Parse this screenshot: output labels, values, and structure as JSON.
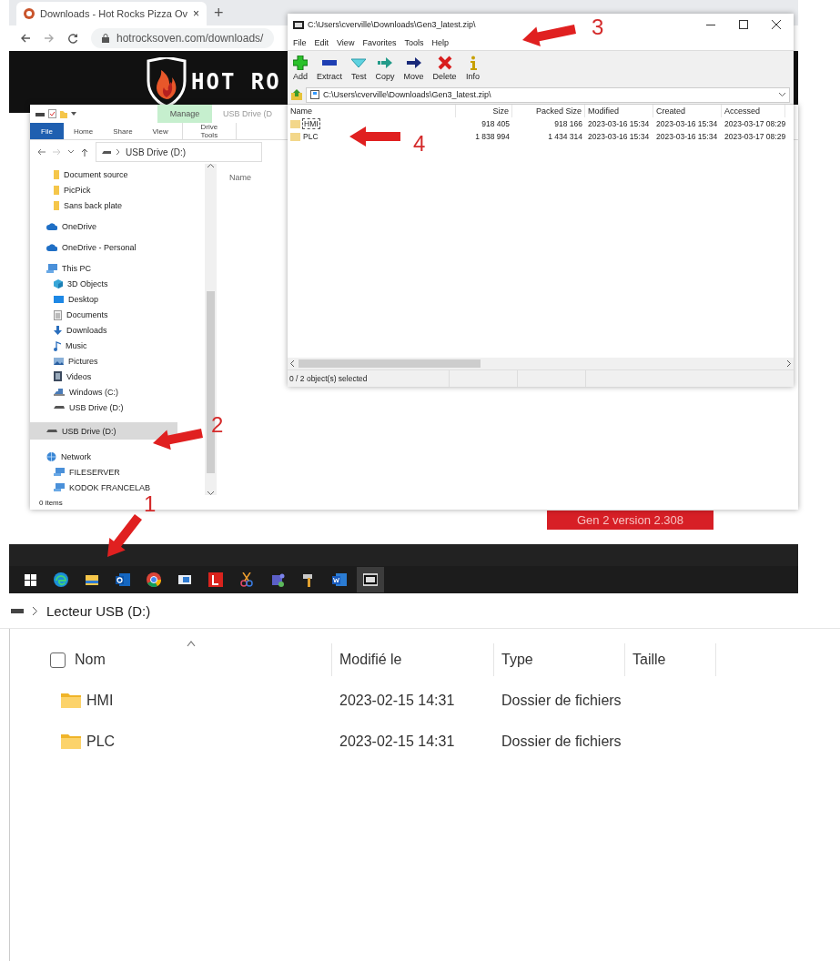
{
  "browser": {
    "tab_title": "Downloads - Hot Rocks Pizza Ov",
    "tab_close": "×",
    "new_tab": "+",
    "url": "hotrocksoven.com/downloads/",
    "logo_text": "HOT RO",
    "download_button": "Gen 2 version 2.308"
  },
  "explorer": {
    "contextual_label": "Manage",
    "title": "USB Drive (D",
    "ribbon_tabs": [
      {
        "label": "File",
        "kind": "file"
      },
      {
        "label": "Home",
        "kind": "tab"
      },
      {
        "label": "Share",
        "kind": "tab"
      },
      {
        "label": "View",
        "kind": "tab"
      },
      {
        "label": "Drive Tools",
        "kind": "contextual"
      }
    ],
    "address": "USB Drive (D:)",
    "column": "Name",
    "nav": [
      {
        "label": "Document source",
        "kind": "folder",
        "selected": false
      },
      {
        "label": "PicPick",
        "kind": "folder",
        "selected": false
      },
      {
        "label": "Sans back plate",
        "kind": "folder",
        "selected": false
      },
      {
        "label": "OneDrive",
        "kind": "cloud",
        "selected": false
      },
      {
        "label": "OneDrive - Personal",
        "kind": "cloud",
        "selected": false
      },
      {
        "label": "This PC",
        "kind": "pc",
        "selected": false,
        "children": [
          {
            "label": "3D Objects",
            "kind": "objects",
            "selected": false
          },
          {
            "label": "Desktop",
            "kind": "desktop",
            "selected": false
          },
          {
            "label": "Documents",
            "kind": "documents",
            "selected": false
          },
          {
            "label": "Downloads",
            "kind": "downloads",
            "selected": false
          },
          {
            "label": "Music",
            "kind": "music",
            "selected": false
          },
          {
            "label": "Pictures",
            "kind": "pictures",
            "selected": false
          },
          {
            "label": "Videos",
            "kind": "videos",
            "selected": false
          },
          {
            "label": "Windows (C:)",
            "kind": "disk",
            "selected": false
          },
          {
            "label": "USB Drive (D:)",
            "kind": "usb",
            "selected": false
          }
        ]
      },
      {
        "label": "USB Drive (D:)",
        "kind": "usb",
        "selected": true
      },
      {
        "label": "Network",
        "kind": "network",
        "selected": false,
        "children": [
          {
            "label": "FILESERVER",
            "kind": "server",
            "selected": false
          },
          {
            "label": "KODOK FRANCELAB",
            "kind": "server",
            "selected": false
          }
        ]
      }
    ],
    "status": "0 items"
  },
  "archiver": {
    "title": "C:\\Users\\cverville\\Downloads\\Gen3_latest.zip\\",
    "menu": [
      "File",
      "Edit",
      "View",
      "Favorites",
      "Tools",
      "Help"
    ],
    "toolbar": [
      {
        "label": "Add",
        "kind": "add"
      },
      {
        "label": "Extract",
        "kind": "extract"
      },
      {
        "label": "Test",
        "kind": "test"
      },
      {
        "label": "Copy",
        "kind": "copy"
      },
      {
        "label": "Move",
        "kind": "move"
      },
      {
        "label": "Delete",
        "kind": "delete"
      },
      {
        "label": "Info",
        "kind": "info"
      }
    ],
    "path": "C:\\Users\\cverville\\Downloads\\Gen3_latest.zip\\",
    "columns": [
      "Name",
      "Size",
      "Packed Size",
      "Modified",
      "Created",
      "Accessed"
    ],
    "rows": [
      {
        "cells": [
          "HMI",
          "918 405",
          "918 166",
          "2023-03-16 15:34",
          "2023-03-16 15:34",
          "2023-03-17 08:29"
        ],
        "focused": true
      },
      {
        "cells": [
          "PLC",
          "1 838 994",
          "1 434 314",
          "2023-03-16 15:34",
          "2023-03-16 15:34",
          "2023-03-17 08:29"
        ],
        "focused": false
      }
    ],
    "status": "0 / 2 object(s) selected"
  },
  "taskbar": [
    {
      "kind": "start",
      "selected": false
    },
    {
      "kind": "edge",
      "selected": false
    },
    {
      "kind": "explorer",
      "selected": false
    },
    {
      "kind": "outlook",
      "selected": false
    },
    {
      "kind": "chrome",
      "selected": false
    },
    {
      "kind": "window",
      "selected": false
    },
    {
      "kind": "letter",
      "selected": false
    },
    {
      "kind": "snip",
      "selected": false
    },
    {
      "kind": "teams",
      "selected": false
    },
    {
      "kind": "hammer",
      "selected": false
    },
    {
      "kind": "word",
      "selected": false
    },
    {
      "kind": "archive",
      "selected": true
    }
  ],
  "annotations": [
    "1",
    "2",
    "3",
    "4"
  ],
  "lower_explorer": {
    "breadcrumb": "Lecteur USB (D:)",
    "select_all_checked": false,
    "columns": [
      "Nom",
      "Modifié le",
      "Type",
      "Taille"
    ],
    "rows": [
      {
        "name": "HMI",
        "modified": "2023-02-15 14:31",
        "type": "Dossier de fichiers"
      },
      {
        "name": "PLC",
        "modified": "2023-02-15 14:31",
        "type": "Dossier de fichiers"
      }
    ]
  }
}
